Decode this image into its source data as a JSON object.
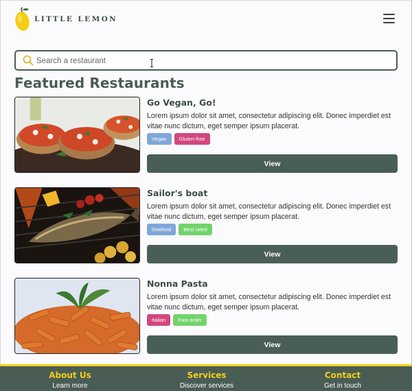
{
  "header": {
    "brand": "LITTLE LEMON",
    "logo_icon": "lemon-logo-icon",
    "menu_icon": "hamburger-menu-icon"
  },
  "search": {
    "icon": "search-icon",
    "placeholder": "Search a restaurant",
    "value": ""
  },
  "page_title": "Featured Restaurants",
  "restaurants": [
    {
      "name": "Go Vegan, Go!",
      "description": "Lorem ipsum dolor sit amet, consectetur adipiscing elit. Donec imperdiet est vitae nunc dictum, eget semper ipsum placerat.",
      "image": "bruschetta-photo",
      "tags": [
        {
          "label": "Vegan",
          "color": "#7ea7d8"
        },
        {
          "label": "Gluten-free",
          "color": "#d2477f"
        }
      ],
      "button_label": "View"
    },
    {
      "name": "Sailor's boat",
      "description": "Lorem ipsum dolor sit amet, consectetur adipiscing elit. Donec imperdiet est vitae nunc dictum, eget semper ipsum placerat.",
      "image": "grilled-fish-photo",
      "tags": [
        {
          "label": "Seafood",
          "color": "#7ea7d8"
        },
        {
          "label": "Best rated",
          "color": "#73d36b"
        }
      ],
      "button_label": "View"
    },
    {
      "name": "Nonna Pasta",
      "description": "Lorem ipsum dolor sit amet, consectetur adipiscing elit. Donec imperdiet est vitae nunc dictum, eget semper ipsum placerat.",
      "image": "penne-pasta-photo",
      "tags": [
        {
          "label": "Italian",
          "color": "#d2477f"
        },
        {
          "label": "Fast order",
          "color": "#73d36b"
        }
      ],
      "button_label": "View"
    }
  ],
  "footer": {
    "columns": [
      {
        "title": "About Us",
        "link": "Learn more"
      },
      {
        "title": "Services",
        "link": "Discover services"
      },
      {
        "title": "Contact",
        "link": "Get in touch"
      }
    ]
  },
  "colors": {
    "primary": "#495e57",
    "accent": "#f4ce14",
    "background": "#fbfbfd"
  }
}
